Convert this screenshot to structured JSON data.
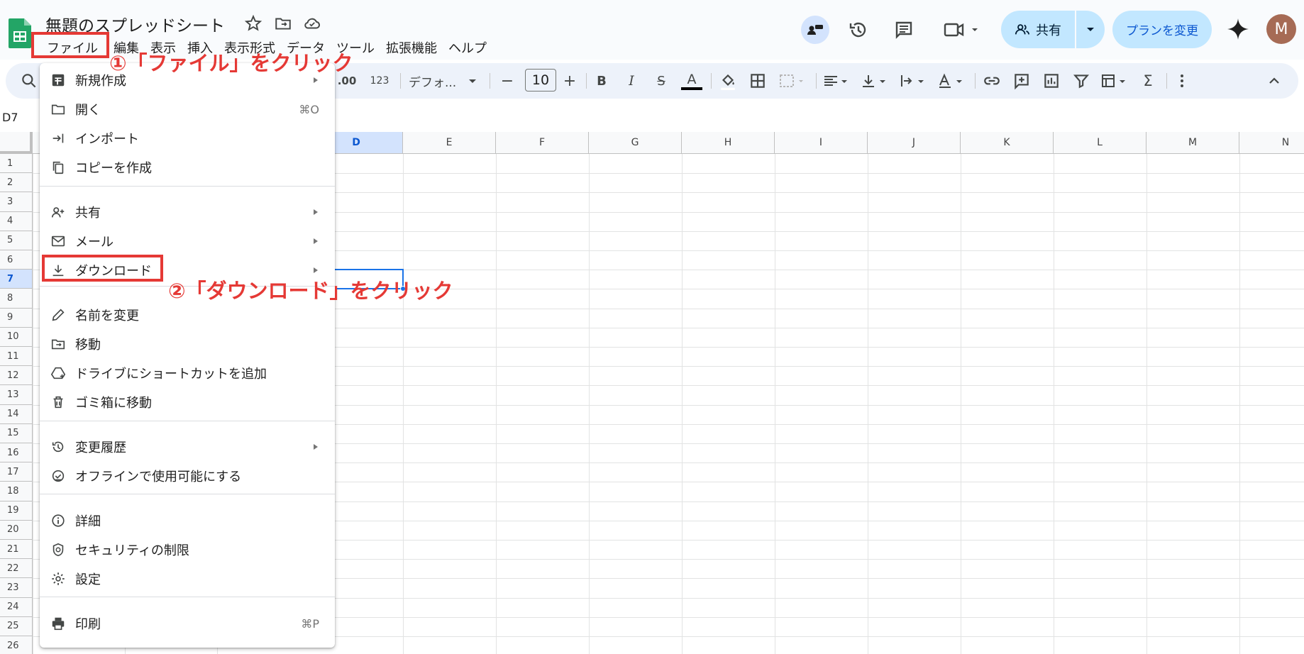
{
  "document": {
    "title": "無題のスプレッドシート"
  },
  "menubar": {
    "items": [
      "ファイル",
      "編集",
      "表示",
      "挿入",
      "表示形式",
      "データ",
      "ツール",
      "拡張機能",
      "ヘルプ"
    ]
  },
  "header": {
    "share_label": "共有",
    "plan_label": "プランを変更",
    "avatar_letter": "M"
  },
  "toolbar": {
    "decimal_increase": ".00",
    "number_format": "123",
    "font_name": "デフォ...",
    "font_size": "10",
    "minus": "−",
    "plus": "+",
    "bold": "B",
    "italic": "I",
    "strike": "S",
    "text_color": "A",
    "sum": "Σ"
  },
  "name_box": "D7",
  "sheet": {
    "columns": [
      "D",
      "E",
      "F",
      "G",
      "H",
      "I",
      "J",
      "K",
      "L",
      "M",
      "N"
    ],
    "selected_column": "D",
    "rows": [
      "1",
      "2",
      "3",
      "4",
      "5",
      "6",
      "7",
      "8",
      "9",
      "10",
      "11",
      "12",
      "13",
      "14",
      "15",
      "16",
      "17",
      "18",
      "19",
      "20",
      "21",
      "22",
      "23",
      "24",
      "25",
      "26"
    ],
    "selected_row": "7"
  },
  "file_menu": {
    "items": [
      {
        "label": "新規作成",
        "icon": "new-sheet-icon",
        "submenu": true
      },
      {
        "label": "開く",
        "icon": "folder-icon",
        "shortcut": "⌘O"
      },
      {
        "label": "インポート",
        "icon": "import-icon"
      },
      {
        "label": "コピーを作成",
        "icon": "copy-icon"
      },
      {
        "label": "共有",
        "icon": "person-add-icon",
        "submenu": true
      },
      {
        "label": "メール",
        "icon": "mail-icon",
        "submenu": true
      },
      {
        "label": "ダウンロード",
        "icon": "download-icon",
        "submenu": true
      },
      {
        "label": "名前を変更",
        "icon": "pencil-icon"
      },
      {
        "label": "移動",
        "icon": "move-folder-icon"
      },
      {
        "label": "ドライブにショートカットを追加",
        "icon": "drive-shortcut-icon"
      },
      {
        "label": "ゴミ箱に移動",
        "icon": "trash-icon"
      },
      {
        "label": "変更履歴",
        "icon": "history-icon",
        "submenu": true
      },
      {
        "label": "オフラインで使用可能にする",
        "icon": "offline-icon"
      },
      {
        "label": "詳細",
        "icon": "info-icon"
      },
      {
        "label": "セキュリティの制限",
        "icon": "security-icon"
      },
      {
        "label": "設定",
        "icon": "gear-icon"
      },
      {
        "label": "印刷",
        "icon": "print-icon",
        "shortcut": "⌘P"
      }
    ]
  },
  "annotations": {
    "step1": "①「ファイル」をクリック",
    "step2": "②「ダウンロード」をクリック"
  },
  "colors": {
    "annotation_red": "#e53935",
    "selection_blue": "#1a73e8",
    "share_button_bg": "#c2e7ff",
    "toolbar_bg": "#edf2fa"
  }
}
